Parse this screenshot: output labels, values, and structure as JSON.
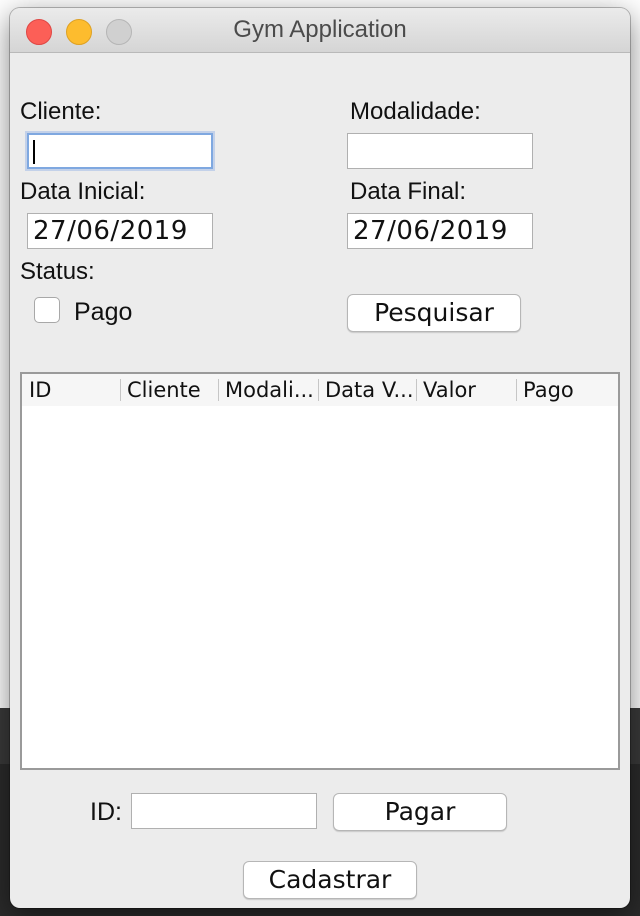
{
  "window": {
    "title": "Gym Application"
  },
  "filters": {
    "cliente_label": "Cliente:",
    "cliente_value": "",
    "modalidade_label": "Modalidade:",
    "modalidade_value": "",
    "data_inicial_label": "Data Inicial:",
    "data_inicial_value": "27/06/2019",
    "data_final_label": "Data Final:",
    "data_final_value": "27/06/2019",
    "status_label": "Status:",
    "pago_label": "Pago",
    "pago_checked": false,
    "pesquisar_label": "Pesquisar"
  },
  "table": {
    "columns": [
      "ID",
      "Cliente",
      "Modali...",
      "Data V...",
      "Valor",
      "Pago"
    ],
    "rows": []
  },
  "footer": {
    "id_label": "ID:",
    "id_value": "",
    "pagar_label": "Pagar",
    "cadastrar_label": "Cadastrar"
  },
  "colors": {
    "window_bg": "#ececec",
    "close": "#fc5f57",
    "minimize": "#fdbc2e",
    "zoom_disabled": "#d0d0d0",
    "focus_ring": "#7fa8e0"
  }
}
